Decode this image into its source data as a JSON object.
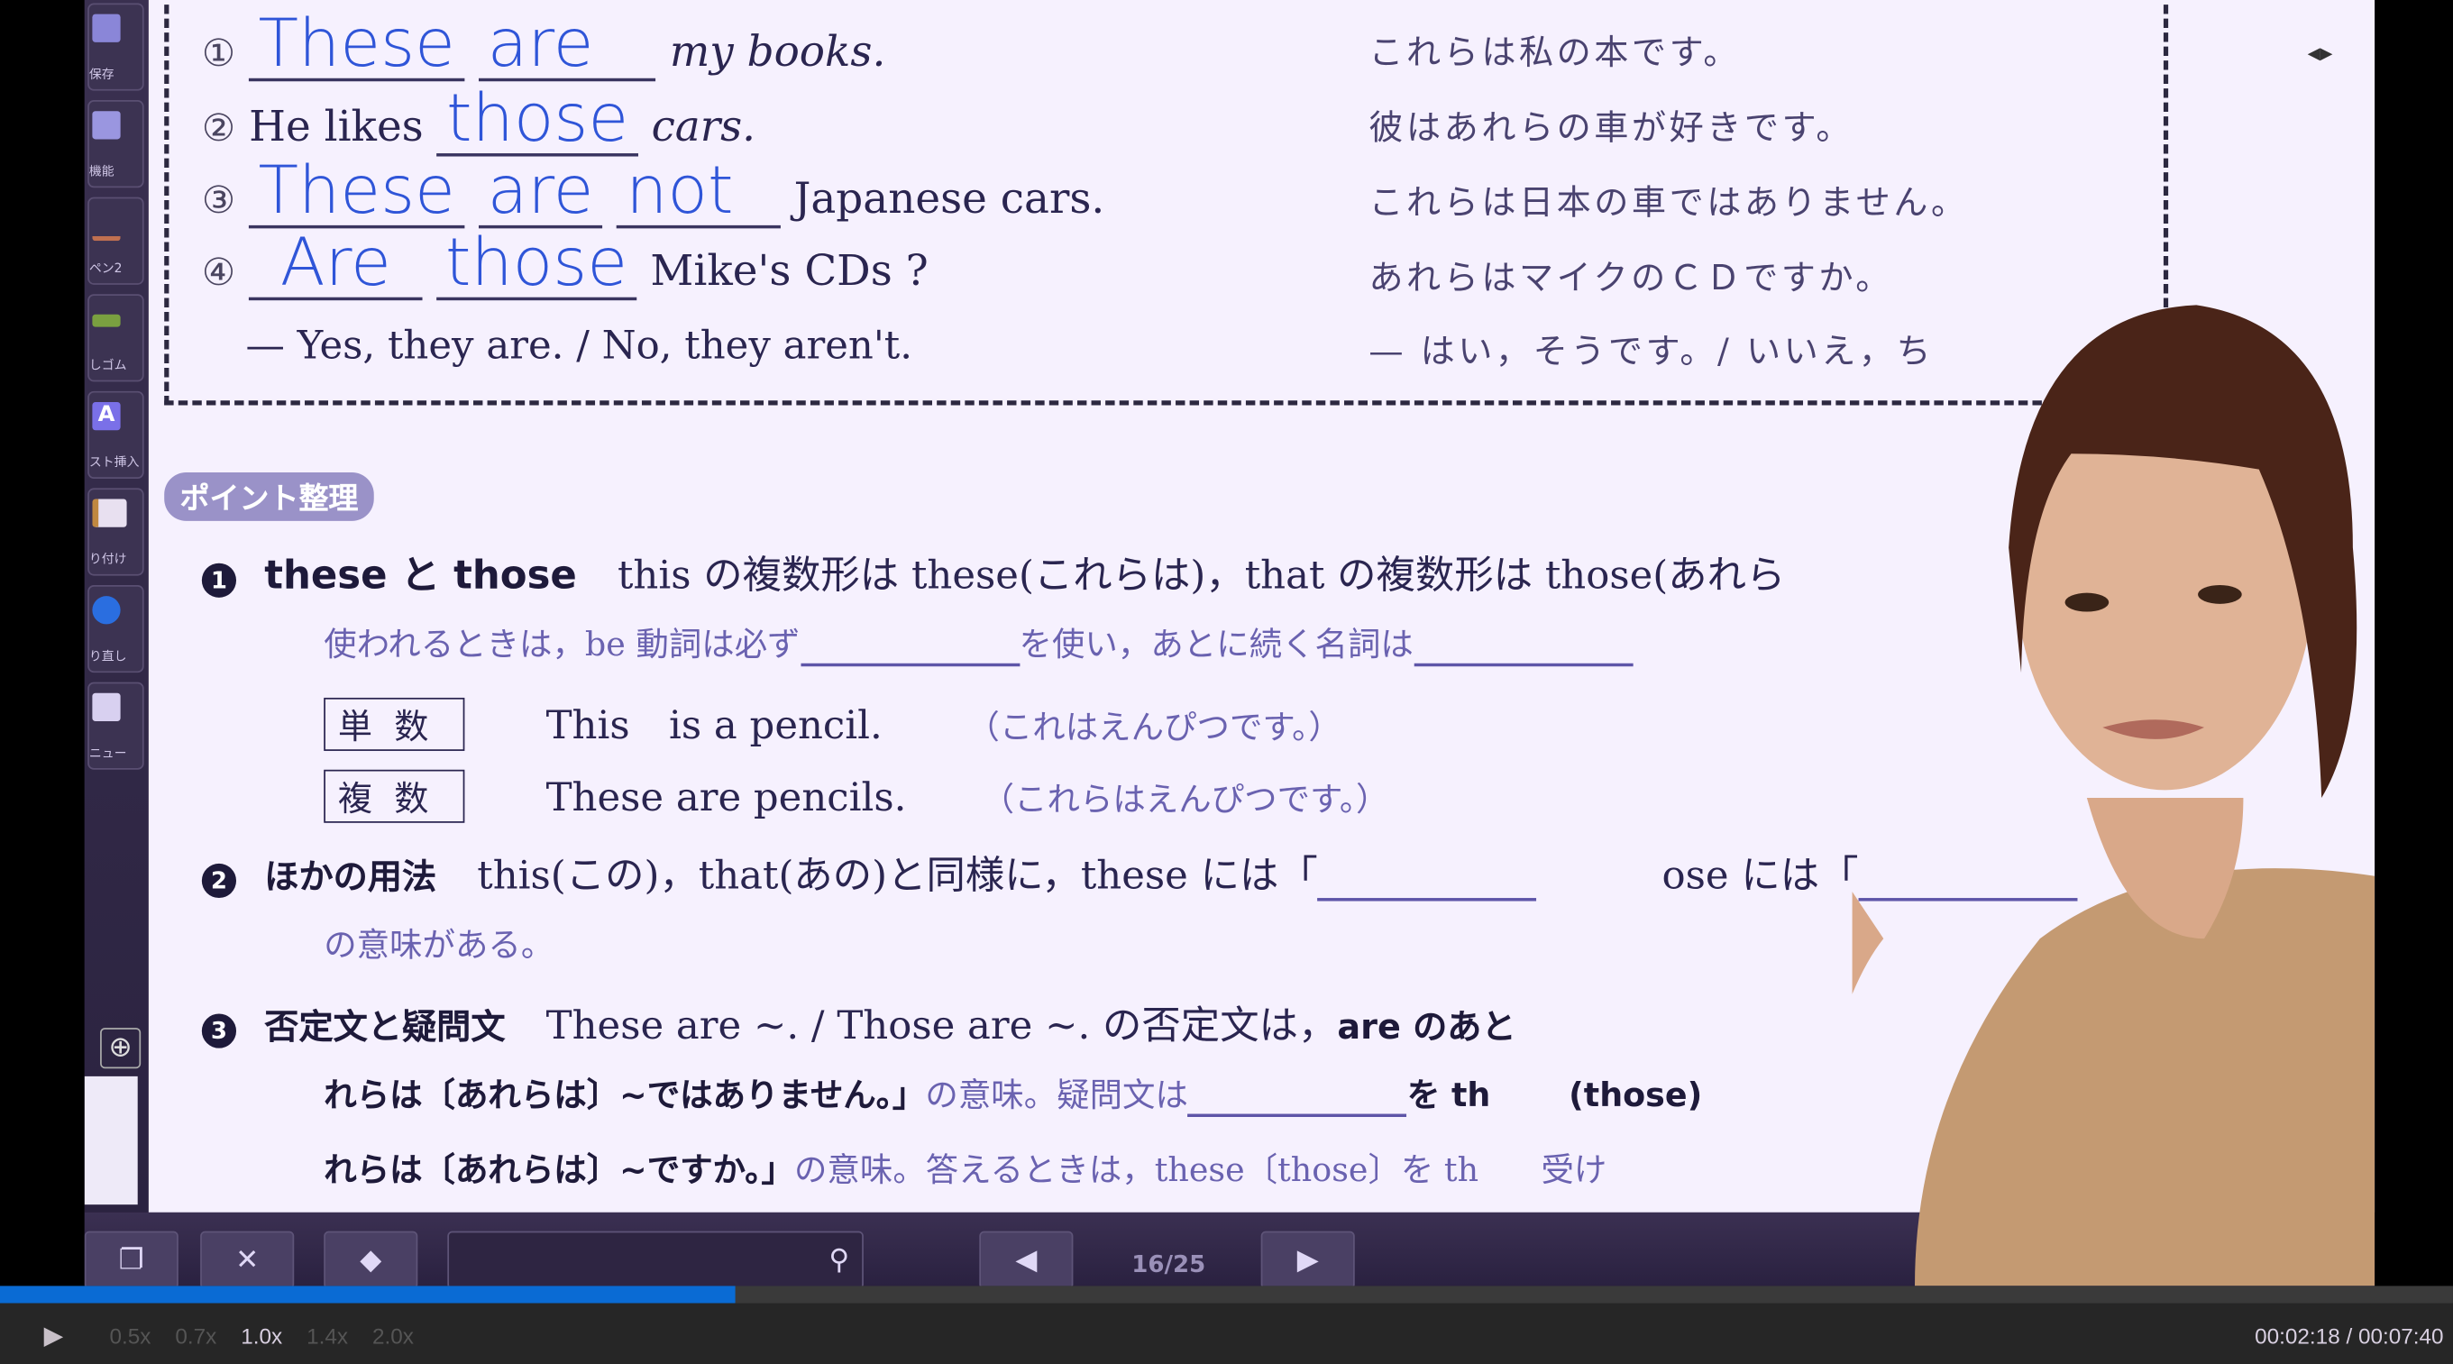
{
  "left_toolbar": {
    "items": [
      {
        "label": "保存",
        "icon": "save-icon",
        "color": "#8a86d8"
      },
      {
        "label": "機能",
        "icon": "folder-icon",
        "color": "#9a96e0"
      },
      {
        "label": "ペン2",
        "icon": "pen-icon",
        "color": "#c07050"
      },
      {
        "label": "しゴム",
        "icon": "eraser-icon",
        "color": "#7aa040"
      },
      {
        "label": "スト挿入",
        "icon": "text-insert-icon",
        "color": "#7a70e8"
      },
      {
        "label": "り付け",
        "icon": "paste-icon",
        "color": "#d0c0a0"
      },
      {
        "label": "り直し",
        "icon": "redo-icon",
        "color": "#2a6ee0"
      },
      {
        "label": "ニュー",
        "icon": "menu-icon",
        "color": "#d8d0f0"
      }
    ]
  },
  "exercise": {
    "rows": [
      {
        "num": "①",
        "answers": [
          "These",
          "are"
        ],
        "rest": "my books.",
        "jp": "これらは私の本です。"
      },
      {
        "num": "②",
        "prefix": "He likes",
        "answers": [
          "those"
        ],
        "rest": "cars.",
        "jp": "彼はあれらの車が好きです。"
      },
      {
        "num": "③",
        "answers": [
          "These",
          "are",
          "not"
        ],
        "rest": "Japanese cars.",
        "jp": "これらは日本の車ではありません。"
      },
      {
        "num": "④",
        "answers": [
          "Are",
          "those"
        ],
        "rest": "Mike's CDs ?",
        "jp": "あれらはマイクのＣＤですか。"
      }
    ],
    "reply": "— Yes, they are. / No, they aren't.",
    "reply_jp": "— はい，そうです。/ いいえ，ち"
  },
  "points": {
    "badge": "ポイント整理",
    "p1": {
      "bullet": "1",
      "title": "these と those",
      "line1": "this の複数形は these(これらは)，that の複数形は those(あれら",
      "line2a": "使われるときは，be 動詞は必ず",
      "line2b": "を使い，あとに続く名詞は",
      "singular_label": "単数",
      "singular_en": "This　is a pencil.",
      "singular_jp": "（これはえんぴつです。）",
      "plural_label": "複数",
      "plural_en": "These are pencils.",
      "plural_jp": "（これらはえんぴつです。）"
    },
    "p2": {
      "bullet": "2",
      "title": "ほかの用法",
      "line1a": "this(この)，that(あの)と同様に，these には「",
      "line1b": "ose には「",
      "line2": "の意味がある。"
    },
    "p3": {
      "bullet": "3",
      "title": "否定文と疑問文",
      "line1": "These are ~. / Those are ~. の否定文は，",
      "line1b": "are のあと",
      "line2a": "れらは〔あれらは〕~ではありません。」",
      "line2b": "の意味。疑問文は",
      "line2c": "を th",
      "line2d": "(those)",
      "line3a": "れらは〔あれらは〕~ですか。」",
      "line3b": "の意味。答えるときは，these〔those〕を th",
      "line3c": "受け"
    }
  },
  "bottom_toolbar": {
    "page": "16/25",
    "search_placeholder": ""
  },
  "player": {
    "progress": 0.3,
    "speeds": [
      "0.5x",
      "0.7x",
      "1.0x",
      "1.4x",
      "2.0x"
    ],
    "active_speed": "1.0x",
    "time": "00:02:18 / 00:07:40",
    "accent": "#0a6bd4"
  }
}
